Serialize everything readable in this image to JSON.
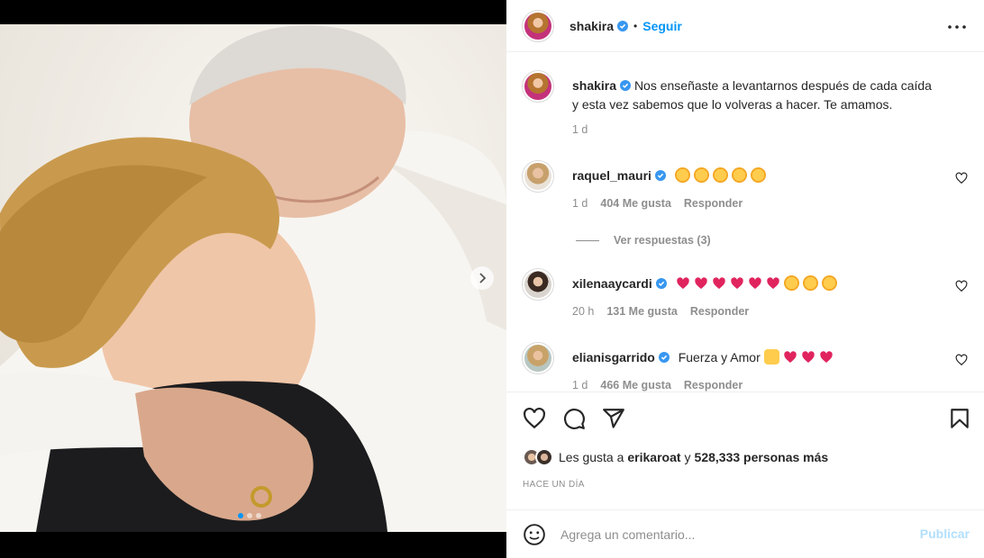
{
  "post": {
    "author": "shakira",
    "follow_label": "Seguir",
    "bullet": "•",
    "caption": "Nos enseñaste a levantarnos después de cada caída y esta vez sabemos que lo volveras a hacer. Te amamos.",
    "caption_age": "1 d",
    "carousel": {
      "slides": 3,
      "active": 1
    }
  },
  "comments": [
    {
      "user": "raquel_mauri",
      "text_emoji": [
        "star-struck",
        "star-struck",
        "star-struck",
        "star-struck",
        "star-struck"
      ],
      "age": "1 d",
      "likes": "404 Me gusta",
      "reply": "Responder",
      "view_replies": "Ver respuestas (3)"
    },
    {
      "user": "xilenaaycardi",
      "text_emoji": [
        "red-heart",
        "red-heart",
        "red-heart",
        "red-heart",
        "red-heart",
        "red-heart",
        "star-struck",
        "star-struck",
        "star-struck"
      ],
      "age": "20 h",
      "likes": "131 Me gusta",
      "reply": "Responder"
    },
    {
      "user": "elianisgarrido",
      "text": "Fuerza y Amor",
      "text_emoji": [
        "raising-hands",
        "red-heart",
        "red-heart",
        "red-heart"
      ],
      "age": "1 d",
      "likes": "466 Me gusta",
      "reply": "Responder"
    }
  ],
  "likes_line": {
    "prefix": "Les gusta a",
    "user": "erikaroat",
    "and": "y",
    "count": "528,333 personas más"
  },
  "timestamp": "HACE UN DÍA",
  "comment_input": {
    "placeholder": "Agrega un comentario...",
    "publish": "Publicar"
  },
  "colors": {
    "accent": "#0095f6",
    "publish_disabled": "#b2dffc",
    "verified": "#3897f0",
    "heart_red": "#e0245e"
  },
  "icons": [
    "more-options-icon",
    "like-icon",
    "comment-icon",
    "share-icon",
    "save-icon",
    "emoji-icon",
    "verified-icon",
    "chevron-right-icon"
  ]
}
